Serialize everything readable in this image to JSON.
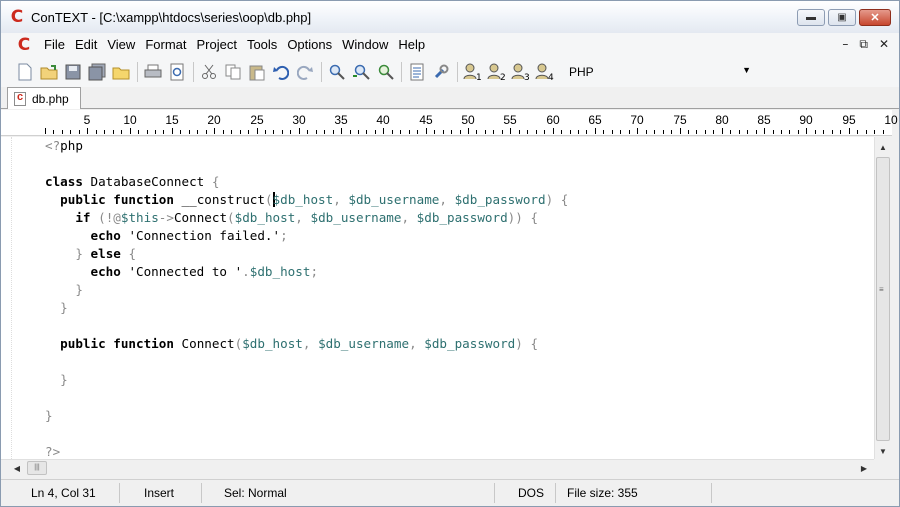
{
  "window": {
    "title": "ConTEXT - [C:\\xampp\\htdocs\\series\\oop\\db.php]",
    "logo_letter": "C",
    "minimize": "▬",
    "maximize": "▣",
    "close": "✕"
  },
  "menu": {
    "items": [
      "File",
      "Edit",
      "View",
      "Format",
      "Project",
      "Tools",
      "Options",
      "Window",
      "Help"
    ],
    "mdi_minimize": "–",
    "mdi_restore": "⧉",
    "mdi_close": "✕"
  },
  "toolbar": {
    "icons": [
      "new-file-icon",
      "open-icon",
      "save-icon",
      "save-all-icon",
      "open-folder-icon",
      "print-icon",
      "print-preview-icon",
      "cut-icon",
      "copy-icon",
      "paste-icon",
      "undo-icon",
      "redo-icon",
      "find-icon",
      "find-next-icon",
      "replace-icon",
      "export-icon",
      "settings-icon",
      "user-exec-1-icon",
      "user-exec-2-icon",
      "user-exec-3-icon",
      "user-exec-4-icon"
    ],
    "language": "PHP"
  },
  "tabs": [
    {
      "label": "db.php"
    }
  ],
  "ruler": {
    "labels": [
      "5",
      "10",
      "15",
      "20",
      "25",
      "30",
      "35",
      "40",
      "45",
      "50",
      "55",
      "60",
      "65",
      "70",
      "75",
      "80",
      "85",
      "90",
      "95",
      "10"
    ]
  },
  "code_lines": [
    "<?php",
    "",
    "class DatabaseConnect {",
    "  public function __construct($db_host, $db_username, $db_password) {",
    "    if (!@$this->Connect($db_host, $db_username, $db_password)) {",
    "      echo 'Connection failed.';",
    "    } else {",
    "      echo 'Connected to '.$db_host;",
    "    }",
    "  }",
    "",
    "  public function Connect($db_host, $db_username, $db_password) {",
    "",
    "  }",
    "",
    "}",
    "",
    "?>"
  ],
  "status": {
    "position": "Ln 4, Col 31",
    "mode": "Insert",
    "selection": "Sel: Normal",
    "line_endings": "DOS",
    "file_size": "File size: 355"
  }
}
